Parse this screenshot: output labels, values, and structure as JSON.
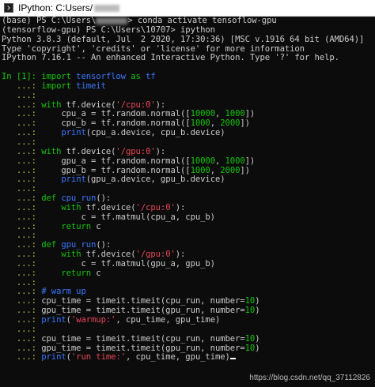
{
  "window": {
    "title_text": "IPython: C:Users/",
    "icon": "terminal-app-icon"
  },
  "colors": {
    "default": "#cccccc",
    "prompt_green": "#16c60c",
    "prompt_cont": "#c2c84c",
    "keyword": "#16c60c",
    "string": "#e74856",
    "number": "#16c60c",
    "name": "#3b78ff",
    "builtin": "#3b78ff",
    "comment": "#3b78ff"
  },
  "lines": [
    {
      "segments": [
        {
          "t": "(base) PS C:\\Users\\",
          "k": "default"
        },
        {
          "redact": true
        },
        {
          "t": "> conda activate tensoflow-gpu",
          "k": "default"
        }
      ]
    },
    {
      "segments": [
        {
          "t": "(tensorflow-gpu) PS C:\\Users\\10707> ipython",
          "k": "default"
        }
      ]
    },
    {
      "segments": [
        {
          "t": "Python 3.8.3 (default, Jul  2 2020, 17:30:36) [MSC v.1916 64 bit (AMD64)]",
          "k": "default"
        }
      ]
    },
    {
      "segments": [
        {
          "t": "Type 'copyright', 'credits' or 'license' for more information",
          "k": "default"
        }
      ]
    },
    {
      "segments": [
        {
          "t": "IPython 7.16.1 -- An enhanced Interactive Python. Type '?' for help.",
          "k": "default"
        }
      ]
    },
    {
      "segments": [
        {
          "t": "",
          "k": "default"
        }
      ]
    },
    {
      "segments": [
        {
          "t": "In [1]: ",
          "k": "prompt_green"
        },
        {
          "t": "import",
          "k": "keyword"
        },
        {
          "t": " tensorflow ",
          "k": "name"
        },
        {
          "t": "as",
          "k": "keyword"
        },
        {
          "t": " tf",
          "k": "name"
        }
      ]
    },
    {
      "segments": [
        {
          "t": "   ...: ",
          "k": "prompt_cont"
        },
        {
          "t": "import",
          "k": "keyword"
        },
        {
          "t": " timeit",
          "k": "name"
        }
      ]
    },
    {
      "segments": [
        {
          "t": "   ...: ",
          "k": "prompt_cont"
        }
      ]
    },
    {
      "segments": [
        {
          "t": "   ...: ",
          "k": "prompt_cont"
        },
        {
          "t": "with",
          "k": "keyword"
        },
        {
          "t": " tf.device(",
          "k": "default"
        },
        {
          "t": "'/cpu:0'",
          "k": "string"
        },
        {
          "t": "):",
          "k": "default"
        }
      ]
    },
    {
      "segments": [
        {
          "t": "   ...: ",
          "k": "prompt_cont"
        },
        {
          "t": "    cpu_a = tf.random.normal([",
          "k": "default"
        },
        {
          "t": "10000",
          "k": "number"
        },
        {
          "t": ", ",
          "k": "default"
        },
        {
          "t": "1000",
          "k": "number"
        },
        {
          "t": "])",
          "k": "default"
        }
      ]
    },
    {
      "segments": [
        {
          "t": "   ...: ",
          "k": "prompt_cont"
        },
        {
          "t": "    cpu_b = tf.random.normal([",
          "k": "default"
        },
        {
          "t": "1000",
          "k": "number"
        },
        {
          "t": ", ",
          "k": "default"
        },
        {
          "t": "2000",
          "k": "number"
        },
        {
          "t": "])",
          "k": "default"
        }
      ]
    },
    {
      "segments": [
        {
          "t": "   ...: ",
          "k": "prompt_cont"
        },
        {
          "t": "    ",
          "k": "default"
        },
        {
          "t": "print",
          "k": "builtin"
        },
        {
          "t": "(cpu_a.device, cpu_b.device)",
          "k": "default"
        }
      ]
    },
    {
      "segments": [
        {
          "t": "   ...: ",
          "k": "prompt_cont"
        }
      ]
    },
    {
      "segments": [
        {
          "t": "   ...: ",
          "k": "prompt_cont"
        },
        {
          "t": "with",
          "k": "keyword"
        },
        {
          "t": " tf.device(",
          "k": "default"
        },
        {
          "t": "'/gpu:0'",
          "k": "string"
        },
        {
          "t": "):",
          "k": "default"
        }
      ]
    },
    {
      "segments": [
        {
          "t": "   ...: ",
          "k": "prompt_cont"
        },
        {
          "t": "    gpu_a = tf.random.normal([",
          "k": "default"
        },
        {
          "t": "10000",
          "k": "number"
        },
        {
          "t": ", ",
          "k": "default"
        },
        {
          "t": "1000",
          "k": "number"
        },
        {
          "t": "])",
          "k": "default"
        }
      ]
    },
    {
      "segments": [
        {
          "t": "   ...: ",
          "k": "prompt_cont"
        },
        {
          "t": "    gpu_b = tf.random.normal([",
          "k": "default"
        },
        {
          "t": "1000",
          "k": "number"
        },
        {
          "t": ", ",
          "k": "default"
        },
        {
          "t": "2000",
          "k": "number"
        },
        {
          "t": "])",
          "k": "default"
        }
      ]
    },
    {
      "segments": [
        {
          "t": "   ...: ",
          "k": "prompt_cont"
        },
        {
          "t": "    ",
          "k": "default"
        },
        {
          "t": "print",
          "k": "builtin"
        },
        {
          "t": "(gpu_a.device, gpu_b.device)",
          "k": "default"
        }
      ]
    },
    {
      "segments": [
        {
          "t": "   ...: ",
          "k": "prompt_cont"
        }
      ]
    },
    {
      "segments": [
        {
          "t": "   ...: ",
          "k": "prompt_cont"
        },
        {
          "t": "def",
          "k": "keyword"
        },
        {
          "t": " ",
          "k": "default"
        },
        {
          "t": "cpu_run",
          "k": "name"
        },
        {
          "t": "():",
          "k": "default"
        }
      ]
    },
    {
      "segments": [
        {
          "t": "   ...: ",
          "k": "prompt_cont"
        },
        {
          "t": "    ",
          "k": "default"
        },
        {
          "t": "with",
          "k": "keyword"
        },
        {
          "t": " tf.device(",
          "k": "default"
        },
        {
          "t": "'/cpu:0'",
          "k": "string"
        },
        {
          "t": "):",
          "k": "default"
        }
      ]
    },
    {
      "segments": [
        {
          "t": "   ...: ",
          "k": "prompt_cont"
        },
        {
          "t": "        c = tf.matmul(cpu_a, cpu_b)",
          "k": "default"
        }
      ]
    },
    {
      "segments": [
        {
          "t": "   ...: ",
          "k": "prompt_cont"
        },
        {
          "t": "    ",
          "k": "default"
        },
        {
          "t": "return",
          "k": "keyword"
        },
        {
          "t": " c",
          "k": "default"
        }
      ]
    },
    {
      "segments": [
        {
          "t": "   ...: ",
          "k": "prompt_cont"
        }
      ]
    },
    {
      "segments": [
        {
          "t": "   ...: ",
          "k": "prompt_cont"
        },
        {
          "t": "def",
          "k": "keyword"
        },
        {
          "t": " ",
          "k": "default"
        },
        {
          "t": "gpu_run",
          "k": "name"
        },
        {
          "t": "():",
          "k": "default"
        }
      ]
    },
    {
      "segments": [
        {
          "t": "   ...: ",
          "k": "prompt_cont"
        },
        {
          "t": "    ",
          "k": "default"
        },
        {
          "t": "with",
          "k": "keyword"
        },
        {
          "t": " tf.device(",
          "k": "default"
        },
        {
          "t": "'/gpu:0'",
          "k": "string"
        },
        {
          "t": "):",
          "k": "default"
        }
      ]
    },
    {
      "segments": [
        {
          "t": "   ...: ",
          "k": "prompt_cont"
        },
        {
          "t": "        c = tf.matmul(gpu_a, gpu_b)",
          "k": "default"
        }
      ]
    },
    {
      "segments": [
        {
          "t": "   ...: ",
          "k": "prompt_cont"
        },
        {
          "t": "    ",
          "k": "default"
        },
        {
          "t": "return",
          "k": "keyword"
        },
        {
          "t": " c",
          "k": "default"
        }
      ]
    },
    {
      "segments": [
        {
          "t": "   ...: ",
          "k": "prompt_cont"
        }
      ]
    },
    {
      "segments": [
        {
          "t": "   ...: ",
          "k": "prompt_cont"
        },
        {
          "t": "# warm up",
          "k": "comment"
        }
      ]
    },
    {
      "segments": [
        {
          "t": "   ...: ",
          "k": "prompt_cont"
        },
        {
          "t": "cpu_time = timeit.timeit(cpu_run, number=",
          "k": "default"
        },
        {
          "t": "10",
          "k": "number"
        },
        {
          "t": ")",
          "k": "default"
        }
      ]
    },
    {
      "segments": [
        {
          "t": "   ...: ",
          "k": "prompt_cont"
        },
        {
          "t": "gpu_time = timeit.timeit(gpu_run, number=",
          "k": "default"
        },
        {
          "t": "10",
          "k": "number"
        },
        {
          "t": ")",
          "k": "default"
        }
      ]
    },
    {
      "segments": [
        {
          "t": "   ...: ",
          "k": "prompt_cont"
        },
        {
          "t": "print",
          "k": "builtin"
        },
        {
          "t": "(",
          "k": "default"
        },
        {
          "t": "'warmup:'",
          "k": "string"
        },
        {
          "t": ", cpu_time, gpu_time)",
          "k": "default"
        }
      ]
    },
    {
      "segments": [
        {
          "t": "   ...: ",
          "k": "prompt_cont"
        }
      ]
    },
    {
      "segments": [
        {
          "t": "   ...: ",
          "k": "prompt_cont"
        },
        {
          "t": "cpu_time = timeit.timeit(cpu_run, number=",
          "k": "default"
        },
        {
          "t": "10",
          "k": "number"
        },
        {
          "t": ")",
          "k": "default"
        }
      ]
    },
    {
      "segments": [
        {
          "t": "   ...: ",
          "k": "prompt_cont"
        },
        {
          "t": "gpu_time = timeit.timeit(gpu_run, number=",
          "k": "default"
        },
        {
          "t": "10",
          "k": "number"
        },
        {
          "t": ")",
          "k": "default"
        }
      ]
    },
    {
      "segments": [
        {
          "t": "   ...: ",
          "k": "prompt_cont"
        },
        {
          "t": "print",
          "k": "builtin"
        },
        {
          "t": "(",
          "k": "default"
        },
        {
          "t": "'run time:'",
          "k": "string"
        },
        {
          "t": ", cpu_time, gpu_time)",
          "k": "default"
        },
        {
          "cursor": true
        }
      ]
    }
  ],
  "watermark": "https://blog.csdn.net/qq_37112826"
}
